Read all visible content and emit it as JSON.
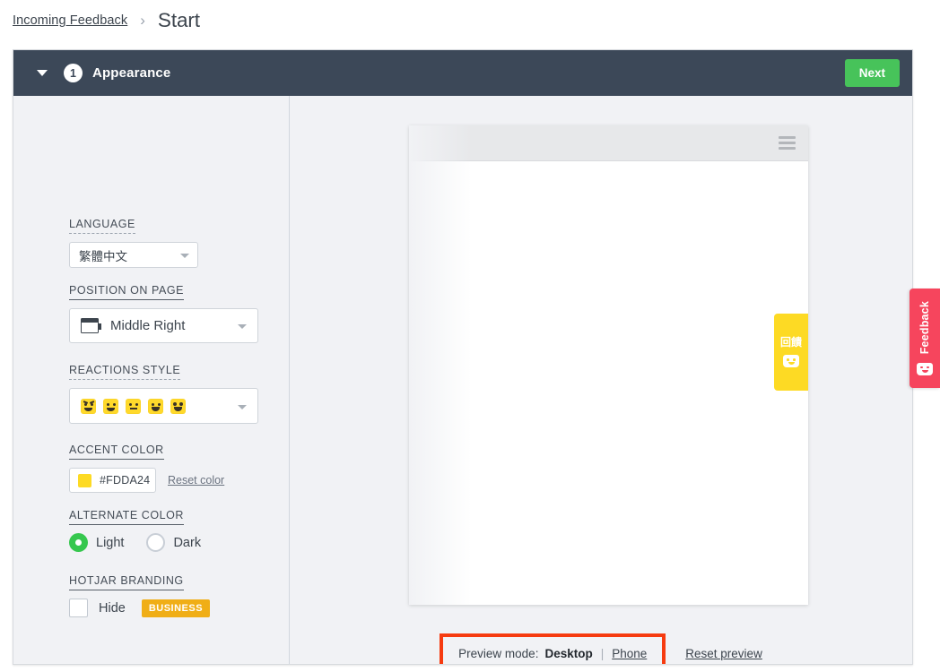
{
  "breadcrumb": {
    "parent": "Incoming Feedback",
    "separator": "›",
    "current": "Start"
  },
  "card_header": {
    "step_number": "1",
    "title": "Appearance",
    "next_label": "Next",
    "collapse_icon": "caret-down-icon",
    "background_color": "#3c4858",
    "next_color": "#47c35a"
  },
  "settings": {
    "language": {
      "label": "LANGUAGE",
      "value": "繁體中文",
      "caret_icon": "chevron-down-icon"
    },
    "position": {
      "label": "POSITION ON PAGE",
      "value": "Middle Right",
      "icon": "browser-window-middle-right-icon",
      "caret_icon": "chevron-down-icon"
    },
    "reactions": {
      "label": "REACTIONS STYLE",
      "caret_icon": "chevron-down-icon",
      "emoji_names": [
        "angry-face-emoji",
        "frowning-face-emoji",
        "neutral-face-emoji",
        "smiling-face-emoji",
        "heart-eyes-face-emoji"
      ]
    },
    "accent": {
      "label": "ACCENT COLOR",
      "value": "#FDDA24",
      "swatch_color": "#FDDA24",
      "reset_label": "Reset color"
    },
    "alternate": {
      "label": "ALTERNATE COLOR",
      "options": [
        {
          "label": "Light",
          "selected": true
        },
        {
          "label": "Dark",
          "selected": false
        }
      ],
      "selected_color": "#36c74e"
    },
    "branding": {
      "label": "HOTJAR BRANDING",
      "hide_label": "Hide",
      "hide_checked": false,
      "plan_badge": "BUSINESS",
      "plan_badge_color": "#f0ae16"
    }
  },
  "preview": {
    "menu_icon": "hamburger-menu-icon",
    "widget": {
      "text": "回饋",
      "face_icon": "smiley-face-icon",
      "color": "#fdda24"
    },
    "mode_label": "Preview mode:",
    "mode_desktop": "Desktop",
    "mode_divider": "|",
    "mode_phone": "Phone",
    "reset_label": "Reset preview",
    "highlight_color": "#f63b10"
  },
  "side_tab": {
    "text": "Feedback",
    "face_icon": "smiley-face-icon",
    "color": "#f6455d"
  }
}
